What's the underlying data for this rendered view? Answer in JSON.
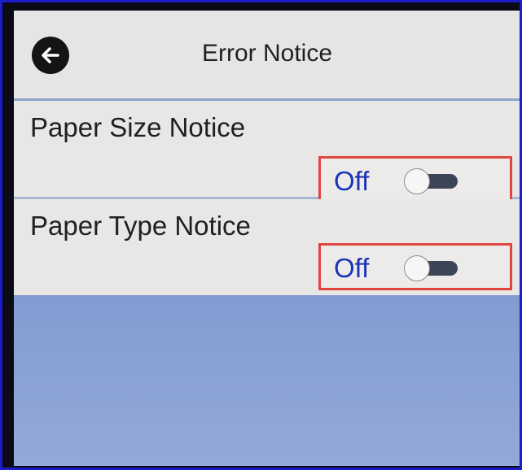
{
  "header": {
    "title": "Error Notice",
    "back_icon": "arrow-left-icon"
  },
  "settings": [
    {
      "label": "Paper Size Notice",
      "state": "Off",
      "enabled": false
    },
    {
      "label": "Paper Type Notice",
      "state": "Off",
      "enabled": false
    }
  ],
  "colors": {
    "highlight_box": "#e0453e",
    "state_text": "#1a34b8",
    "screen_background": "#7f98cf"
  }
}
